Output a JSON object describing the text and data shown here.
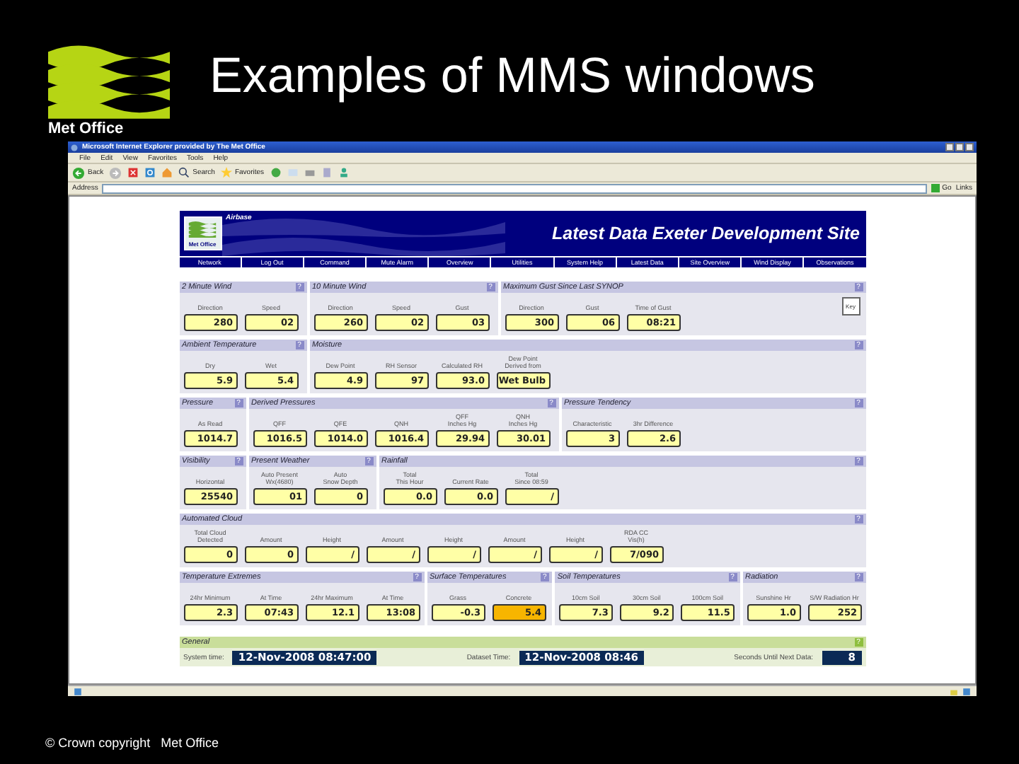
{
  "slide": {
    "title": "Examples of MMS windows",
    "logo_text": "Met Office",
    "footer": "© Crown copyright   Met Office"
  },
  "browser": {
    "title": "Microsoft Internet Explorer provided by The Met Office",
    "menu": [
      "File",
      "Edit",
      "View",
      "Favorites",
      "Tools",
      "Help"
    ],
    "back": "Back",
    "search": "Search",
    "favorites": "Favorites",
    "address_label": "Address",
    "go": "Go",
    "links": "Links"
  },
  "page": {
    "brand": "Airbase",
    "logo_text": "Met Office",
    "heading": "Latest Data Exeter Development Site",
    "nav": [
      "Network",
      "Log Out",
      "Command",
      "Mute Alarm",
      "Overview",
      "Utilities",
      "System Help",
      "Latest Data",
      "Site Overview",
      "Wind Display",
      "Observations"
    ],
    "key_button": "Key",
    "rows": [
      {
        "panels": [
          {
            "title": "2 Minute Wind",
            "help": "?",
            "fields": [
              {
                "label": "Direction",
                "value": "280",
                "alert": false
              },
              {
                "label": "Speed",
                "value": "02",
                "alert": false
              }
            ]
          },
          {
            "title": "10 Minute Wind",
            "help": "?",
            "fields": [
              {
                "label": "Direction",
                "value": "260",
                "alert": false
              },
              {
                "label": "Speed",
                "value": "02",
                "alert": false
              },
              {
                "label": "Gust",
                "value": "03",
                "alert": false
              }
            ]
          },
          {
            "title": "Maximum Gust Since Last SYNOP",
            "help": "?",
            "key": true,
            "fields": [
              {
                "label": "Direction",
                "value": "300",
                "alert": false
              },
              {
                "label": "Gust",
                "value": "06",
                "alert": false
              },
              {
                "label": "Time of Gust",
                "value": "08:21",
                "alert": false
              }
            ]
          }
        ]
      },
      {
        "panels": [
          {
            "title": "Ambient Temperature",
            "help": "?",
            "fields": [
              {
                "label": "Dry",
                "value": "5.9",
                "alert": false
              },
              {
                "label": "Wet",
                "value": "5.4",
                "alert": false
              }
            ]
          },
          {
            "title": "Moisture",
            "help": "?",
            "fields": [
              {
                "label": "Dew Point",
                "value": "4.9",
                "alert": false
              },
              {
                "label": "RH Sensor",
                "value": "97",
                "alert": false
              },
              {
                "label": "Calculated RH",
                "value": "93.0",
                "alert": false
              },
              {
                "label": "Dew Point\nDerived from",
                "value": "Wet Bulb",
                "alert": false
              }
            ]
          }
        ]
      },
      {
        "panels": [
          {
            "title": "Pressure",
            "help": "?",
            "fields": [
              {
                "label": "As Read",
                "value": "1014.7",
                "alert": false
              }
            ]
          },
          {
            "title": "Derived Pressures",
            "help": "?",
            "fields": [
              {
                "label": "QFF",
                "value": "1016.5",
                "alert": false
              },
              {
                "label": "QFE",
                "value": "1014.0",
                "alert": false
              },
              {
                "label": "QNH",
                "value": "1016.4",
                "alert": false
              },
              {
                "label": "QFF\nInches Hg",
                "value": "29.94",
                "alert": false
              },
              {
                "label": "QNH\nInches Hg",
                "value": "30.01",
                "alert": false
              }
            ]
          },
          {
            "title": "Pressure Tendency",
            "help": "?",
            "fields": [
              {
                "label": "Characteristic",
                "value": "3",
                "alert": false
              },
              {
                "label": "3hr Difference",
                "value": "2.6",
                "alert": false
              }
            ]
          }
        ]
      },
      {
        "panels": [
          {
            "title": "Visibility",
            "help": "?",
            "fields": [
              {
                "label": "Horizontal",
                "value": "25540",
                "alert": false
              }
            ]
          },
          {
            "title": "Present Weather",
            "help": "?",
            "fields": [
              {
                "label": "Auto Present\nWx(4680)",
                "value": "01",
                "alert": false
              },
              {
                "label": "Auto\nSnow Depth",
                "value": "0",
                "alert": false
              }
            ]
          },
          {
            "title": "Rainfall",
            "help": "?",
            "fields": [
              {
                "label": "Total\nThis Hour",
                "value": "0.0",
                "alert": false
              },
              {
                "label": "Current Rate",
                "value": "0.0",
                "alert": false
              },
              {
                "label": "Total\nSince 08:59",
                "value": "/",
                "alert": false
              }
            ]
          }
        ]
      },
      {
        "panels": [
          {
            "title": "Automated Cloud",
            "help": "?",
            "fields": [
              {
                "label": "Total Cloud\nDetected",
                "value": "0",
                "alert": false
              },
              {
                "label": "Amount",
                "value": "0",
                "alert": false
              },
              {
                "label": "Height",
                "value": "/",
                "alert": false
              },
              {
                "label": "Amount",
                "value": "/",
                "alert": false
              },
              {
                "label": "Height",
                "value": "/",
                "alert": false
              },
              {
                "label": "Amount",
                "value": "/",
                "alert": false
              },
              {
                "label": "Height",
                "value": "/",
                "alert": false
              },
              {
                "label": "RDA CC\nVis(h)",
                "value": "7/090",
                "alert": false
              }
            ]
          }
        ]
      },
      {
        "panels": [
          {
            "title": "Temperature Extremes",
            "help": "?",
            "fields": [
              {
                "label": "24hr Minimum",
                "value": "2.3",
                "alert": false
              },
              {
                "label": "At Time",
                "value": "07:43",
                "alert": false
              },
              {
                "label": "24hr Maximum",
                "value": "12.1",
                "alert": false
              },
              {
                "label": "At Time",
                "value": "13:08",
                "alert": false
              }
            ]
          },
          {
            "title": "Surface Temperatures",
            "help": "?",
            "fields": [
              {
                "label": "Grass",
                "value": "-0.3",
                "alert": false
              },
              {
                "label": "Concrete",
                "value": "5.4",
                "alert": true
              }
            ]
          },
          {
            "title": "Soil Temperatures",
            "help": "?",
            "fields": [
              {
                "label": "10cm Soil",
                "value": "7.3",
                "alert": false
              },
              {
                "label": "30cm Soil",
                "value": "9.2",
                "alert": false
              },
              {
                "label": "100cm Soil",
                "value": "11.5",
                "alert": false
              }
            ]
          },
          {
            "title": "Radiation",
            "help": "?",
            "fields": [
              {
                "label": "Sunshine Hr",
                "value": "1.0",
                "alert": false
              },
              {
                "label": "S/W Radiation Hr",
                "value": "252",
                "alert": false
              }
            ]
          }
        ]
      }
    ],
    "general": {
      "title": "General",
      "help": "?",
      "items": [
        {
          "label": "System time:",
          "value": "12-Nov-2008 08:47:00"
        },
        {
          "label": "Dataset Time:",
          "value": "12-Nov-2008 08:46"
        },
        {
          "label": "Seconds Until Next Data:",
          "value": "8"
        }
      ]
    }
  }
}
